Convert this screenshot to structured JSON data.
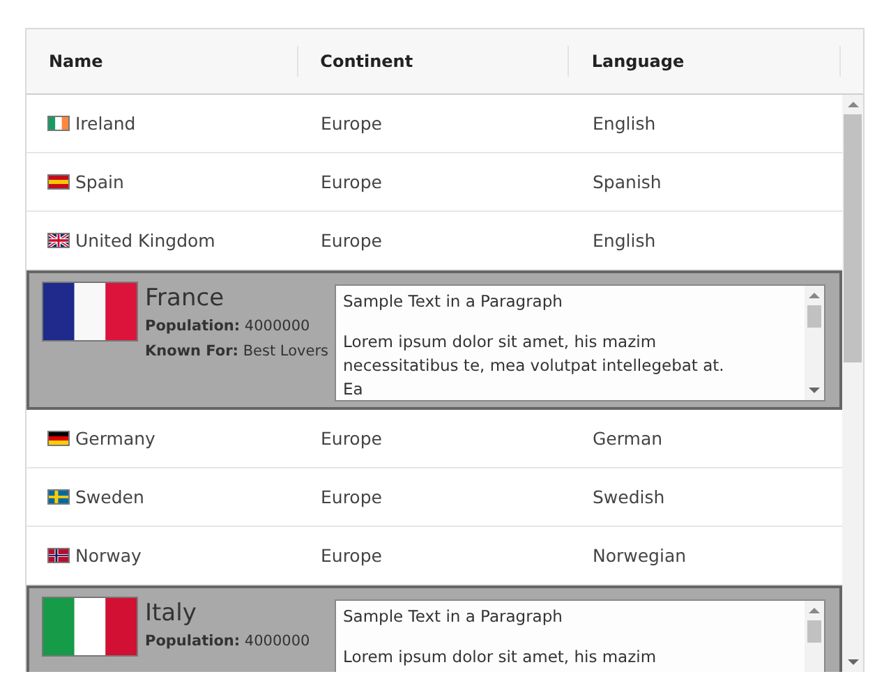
{
  "columns": [
    "Name",
    "Continent",
    "Language"
  ],
  "rows": [
    {
      "kind": "row",
      "name": "Ireland",
      "continent": "Europe",
      "language": "English"
    },
    {
      "kind": "row",
      "name": "Spain",
      "continent": "Europe",
      "language": "Spanish"
    },
    {
      "kind": "row",
      "name": "United Kingdom",
      "continent": "Europe",
      "language": "English"
    },
    {
      "kind": "detail",
      "name": "France",
      "population": "**Population:** 4000000",
      "known_for": "**Known For:** Best Lovers",
      "paragraph_title": "Sample Text in a Paragraph",
      "paragraph": "Lorem ipsum dolor sit amet, his mazim necessitatibus te, mea volutpat intellegebat at. Ea"
    },
    {
      "kind": "row",
      "name": "Germany",
      "continent": "Europe",
      "language": "German"
    },
    {
      "kind": "row",
      "name": "Sweden",
      "continent": "Europe",
      "language": "Swedish"
    },
    {
      "kind": "row",
      "name": "Norway",
      "continent": "Europe",
      "language": "Norwegian"
    },
    {
      "kind": "detail",
      "name": "Italy",
      "population": "**Population:** 4000000",
      "paragraph_title": "Sample Text in a Paragraph",
      "paragraph": "Lorem ipsum dolor sit amet, his mazim"
    }
  ]
}
